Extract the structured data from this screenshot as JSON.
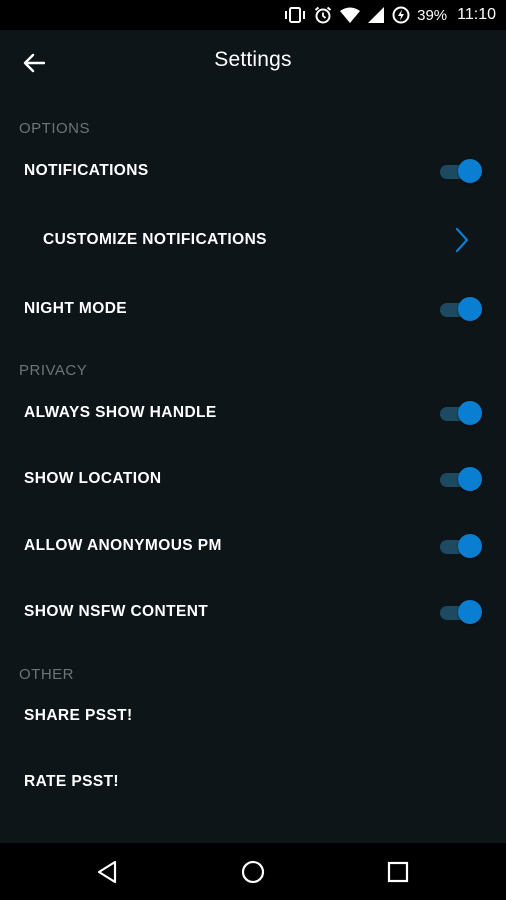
{
  "status_bar": {
    "battery_percent": "39%",
    "time": "11:10",
    "icons": [
      "vibrate-icon",
      "alarm-icon",
      "wifi-icon",
      "signal-icon",
      "battery-charging-icon"
    ]
  },
  "app_bar": {
    "title": "Settings",
    "back_icon": "arrow-left-icon"
  },
  "sections": {
    "options": {
      "header": "OPTIONS",
      "notifications": {
        "label": "NOTIFICATIONS",
        "enabled": true
      },
      "customize_notifications": {
        "label": "CUSTOMIZE NOTIFICATIONS",
        "icon": "chevron-right-icon"
      },
      "night_mode": {
        "label": "NIGHT MODE",
        "enabled": true
      }
    },
    "privacy": {
      "header": "PRIVACY",
      "always_show_handle": {
        "label": "ALWAYS SHOW HANDLE",
        "enabled": true
      },
      "show_location": {
        "label": "SHOW LOCATION",
        "enabled": true
      },
      "allow_anonymous_pm": {
        "label": "ALLOW ANONYMOUS PM",
        "enabled": true
      },
      "show_nsfw_content": {
        "label": "SHOW NSFW CONTENT",
        "enabled": true
      }
    },
    "other": {
      "header": "OTHER",
      "share": {
        "label": "SHARE PSST!"
      },
      "rate": {
        "label": "RATE PSST!"
      }
    }
  },
  "nav_bar": {
    "icons": [
      "back-triangle-icon",
      "home-circle-icon",
      "recents-square-icon"
    ]
  },
  "colors": {
    "background": "#0d1519",
    "accent": "#0a7fd2",
    "toggle_track": "#1d4a61",
    "section_header": "#6c7478"
  }
}
